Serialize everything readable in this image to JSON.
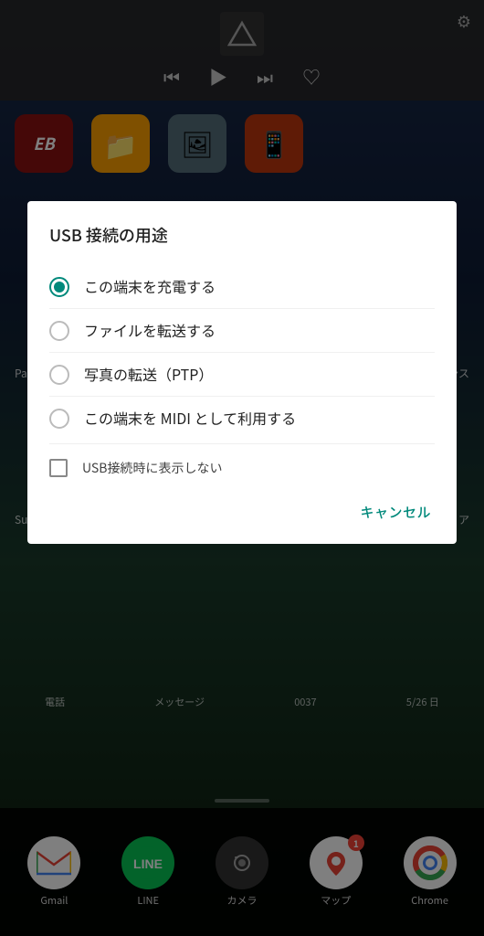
{
  "music_bar": {
    "settings_icon": "⚙",
    "skip_back_icon": "⏮",
    "play_icon": "▶",
    "skip_forward_icon": "⏭",
    "heart_icon": "♡"
  },
  "app_row": {
    "icons": [
      {
        "name": "EB-app",
        "bg": "#8B0000",
        "label": "EB"
      },
      {
        "name": "folder-app",
        "bg": "#FFA000",
        "label": "📁"
      },
      {
        "name": "photo-app",
        "bg": "#546E7A",
        "label": "🖼"
      },
      {
        "name": "unknown-app",
        "bg": "#BF360C",
        "label": "📱"
      }
    ]
  },
  "dialog": {
    "title": "USB 接続の用途",
    "options": [
      {
        "id": "charge",
        "label": "この端末を充電する",
        "selected": true
      },
      {
        "id": "file",
        "label": "ファイルを転送する",
        "selected": false
      },
      {
        "id": "ptp",
        "label": "写真の転送（PTP）",
        "selected": false
      },
      {
        "id": "midi",
        "label": "この端末を MIDI として利用する",
        "selected": false
      }
    ],
    "checkbox": {
      "label": "USB接続時に表示しない",
      "checked": false
    },
    "cancel_button": "キャンセル"
  },
  "bottom_status": {
    "left_labels": [
      "電話",
      "メッセージ",
      "0037",
      "5/26 日"
    ]
  },
  "dock": {
    "items": [
      {
        "id": "gmail",
        "label": "Gmail",
        "badge": null,
        "bg": "#fff"
      },
      {
        "id": "line",
        "label": "LINE",
        "badge": null,
        "bg": "#06C755"
      },
      {
        "id": "camera",
        "label": "カメラ",
        "badge": null,
        "bg": "#333"
      },
      {
        "id": "maps",
        "label": "マップ",
        "badge": "1",
        "bg": "#fff"
      },
      {
        "id": "chrome",
        "label": "Chrome",
        "badge": null,
        "bg": "#fff"
      }
    ]
  }
}
